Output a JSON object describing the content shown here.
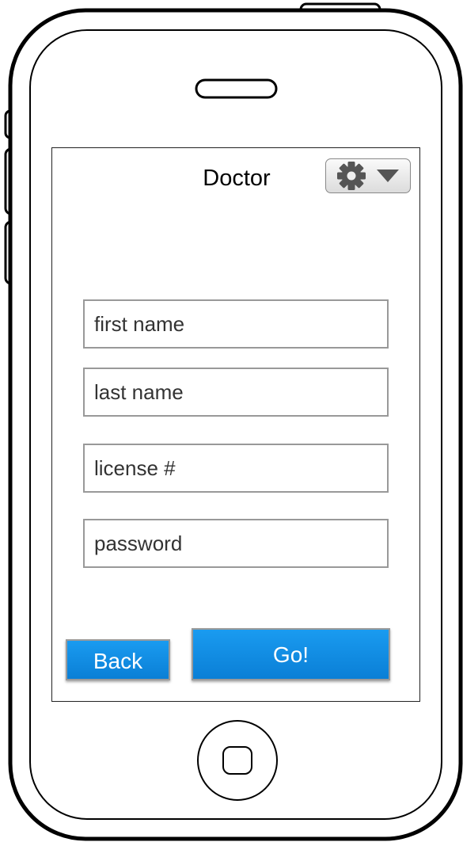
{
  "header": {
    "title": "Doctor"
  },
  "icons": {
    "settings": "gear-icon",
    "dropdown": "triangle-down-icon"
  },
  "form": {
    "first_name_placeholder": "first name",
    "last_name_placeholder": "last name",
    "license_placeholder": "license #",
    "password_placeholder": "password"
  },
  "actions": {
    "back_label": "Back",
    "go_label": "Go!"
  },
  "colors": {
    "button_blue": "#0a84e0",
    "frame": "#000000",
    "field_border": "#999999"
  }
}
